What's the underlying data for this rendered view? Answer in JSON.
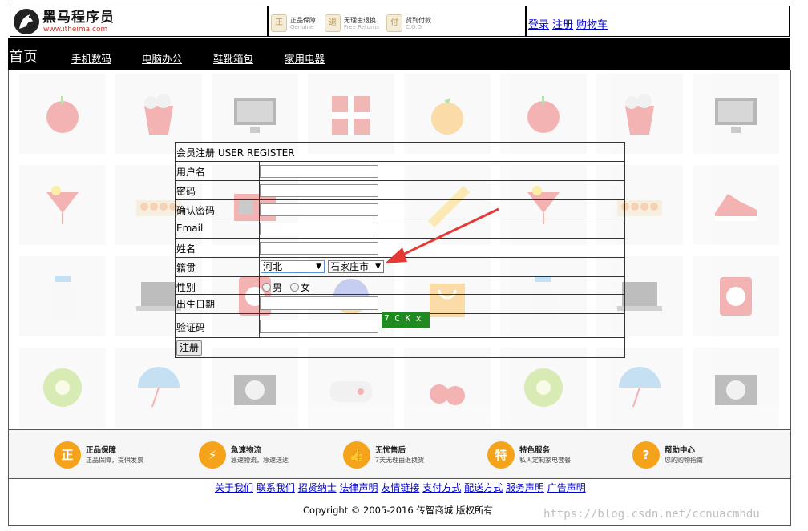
{
  "header": {
    "brand_name": "黑马程序员",
    "brand_url": "www.itheima.com",
    "promos": [
      {
        "icon": "quality-badge-icon",
        "title": "正品保障",
        "subtitle": "Genuine"
      },
      {
        "icon": "return-badge-icon",
        "title": "无理由退换",
        "subtitle": "Free Returns"
      },
      {
        "icon": "cod-badge-icon",
        "title": "货到付款",
        "subtitle": "C.O.D"
      }
    ],
    "links": [
      "登录",
      "注册",
      "购物车"
    ]
  },
  "nav": {
    "home": "首页",
    "items": [
      "手机数码",
      "电脑办公",
      "鞋靴箱包",
      "家用电器"
    ]
  },
  "form": {
    "title": "会员注册 USER REGISTER",
    "labels": {
      "username": "用户名",
      "password": "密码",
      "confirm": "确认密码",
      "email": "Email",
      "name": "姓名",
      "hometown": "籍贯",
      "gender": "性别",
      "birthday": "出生日期",
      "captcha": "验证码"
    },
    "province": "河北",
    "city": "石家庄市",
    "gender_options": [
      "男",
      "女"
    ],
    "captcha_text": "7 C K x",
    "submit": "注册"
  },
  "services": [
    {
      "icon": "正",
      "title": "正品保障",
      "desc": "正品保障，提供发票"
    },
    {
      "icon": "⚡",
      "title": "急速物流",
      "desc": "急速物流，急速送达"
    },
    {
      "icon": "👍",
      "title": "无忧售后",
      "desc": "7天无理由退换货"
    },
    {
      "icon": "特",
      "title": "特色服务",
      "desc": "私人定制家电套餐"
    },
    {
      "icon": "?",
      "title": "帮助中心",
      "desc": "您的购物指南"
    }
  ],
  "footer": {
    "links": [
      "关于我们",
      "联系我们",
      "招贤纳士",
      "法律声明",
      "友情链接",
      "支付方式",
      "配送方式",
      "服务声明",
      "广告声明"
    ],
    "copyright": "Copyright © 2005-2016 传智商城 版权所有"
  },
  "watermark": "https://blog.csdn.net/ccnuacmhdu",
  "colors": {
    "accent": "#f5a31a",
    "link": "#0000cc",
    "arrow": "#e53935",
    "captcha_bg": "#1f8a1f"
  }
}
